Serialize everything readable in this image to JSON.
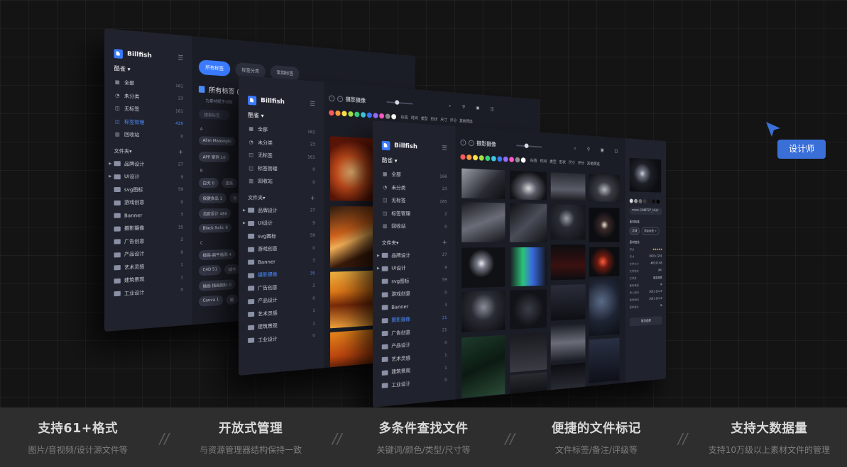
{
  "app": {
    "name": "Billfish",
    "library": "酷雀",
    "library_caret": "▾",
    "menu_icon": "☰",
    "nav": [
      {
        "label": "全部",
        "icon": "grid-icon",
        "glyph": "▦",
        "count": "161"
      },
      {
        "label": "未分类",
        "icon": "pie-icon",
        "glyph": "◔",
        "count": "23"
      },
      {
        "label": "无标签",
        "icon": "tag-icon",
        "glyph": "◫",
        "count": "161"
      },
      {
        "label": "标签管理",
        "icon": "tag-manage-icon",
        "glyph": "◫",
        "count": "429"
      },
      {
        "label": "回收站",
        "icon": "trash-icon",
        "glyph": "▥",
        "count": "0"
      }
    ],
    "folders_label": "文件夹",
    "folders_caret": "▾",
    "plus": "+",
    "folders": [
      {
        "label": "品牌设计",
        "count": "27",
        "expandable": true
      },
      {
        "label": "UI设计",
        "count": "9",
        "expandable": true
      },
      {
        "label": "svg图标",
        "count": "59",
        "expandable": false
      },
      {
        "label": "游戏创意",
        "count": "0",
        "expandable": false
      },
      {
        "label": "Banner",
        "count": "3",
        "expandable": false
      },
      {
        "label": "摄影摄像",
        "count": "35",
        "expandable": false
      },
      {
        "label": "广告创意",
        "count": "2",
        "expandable": false
      },
      {
        "label": "产品设计",
        "count": "0",
        "expandable": false
      },
      {
        "label": "艺术灵感",
        "count": "1",
        "expandable": false
      },
      {
        "label": "建筑景观",
        "count": "1",
        "expandable": false
      },
      {
        "label": "工业设计",
        "count": "0",
        "expandable": false
      }
    ]
  },
  "back_window": {
    "tabs": [
      "所有标签",
      "标签分类",
      "常用标签"
    ],
    "window_controls": "– □ ×",
    "title": "所有标签 (4",
    "subtitle": "为素材赋予对应",
    "search_placeholder": "搜索标签",
    "groups": [
      {
        "letter": "A",
        "rows": [
          [
            "Alim Maasoglu"
          ],
          [
            "APP 案例 10"
          ]
        ]
      },
      {
        "letter": "B",
        "rows": [
          [
            "白天 0",
            "皮肤"
          ],
          [
            "保健食品 1",
            "包"
          ],
          [
            "北欧设计 486"
          ],
          [
            "Black Italic 9"
          ]
        ]
      },
      {
        "letter": "C",
        "rows": [
          [
            "插画-扁平画图 4",
            "城市"
          ],
          [
            "C4D 51",
            "城市"
          ],
          [
            "插画-插画图标 0"
          ],
          [
            "Canva 1",
            "植"
          ]
        ]
      }
    ]
  },
  "mid_window": {
    "folder_counts": [
      "27",
      "9",
      "59",
      "0",
      "3",
      "35",
      "2",
      "0",
      "1",
      "1",
      "0"
    ],
    "nav_counts": [
      "161",
      "23",
      "161",
      "0",
      "0"
    ],
    "active_nav": 3,
    "active_folder": 5,
    "header_title": "摄影摄像",
    "filters": [
      "标签",
      "时间",
      "类型",
      "形状",
      "尺寸",
      "评分",
      "其他筛选"
    ]
  },
  "front_window": {
    "nav_counts": [
      "166",
      "23",
      "165",
      "2",
      "0"
    ],
    "folder_counts": [
      "27",
      "9",
      "59",
      "0",
      "3",
      "21",
      "21",
      "0",
      "1",
      "1",
      "0"
    ],
    "active_folder": 5,
    "header_title": "摄影摄像",
    "filters": [
      "标签",
      "时间",
      "类型",
      "形状",
      "尺寸",
      "评分",
      "其他筛选"
    ],
    "swatches": [
      "#ff5a5a",
      "#ff9a3c",
      "#ffe04a",
      "#a5e04a",
      "#36d17a",
      "#3ac7e0",
      "#3a7bff",
      "#9b6bff",
      "#ff5ac8",
      "#8d8d8d",
      "#ffffff"
    ],
    "detail": {
      "file_name": "moon-2048727_1920",
      "tags_label": "素材标签",
      "tag_chips": [
        "月球",
        "添加标签 +"
      ],
      "info_label": "素材信息",
      "rows": [
        {
          "k": "评分",
          "v": "★★★★★",
          "stars": true
        },
        {
          "k": "尺寸",
          "v": "1920×1281"
        },
        {
          "k": "文件大小",
          "v": "465.95 KB"
        },
        {
          "k": "文件格式",
          "v": "JPG"
        },
        {
          "k": "文件夹",
          "v": "摄影摄像"
        },
        {
          "k": "素材来源",
          "v": "⊞"
        },
        {
          "k": "导入时间",
          "v": "2021-10-29"
        },
        {
          "k": "修改时间",
          "v": "2021-10-29"
        },
        {
          "k": "素材备注",
          "v": "⊞"
        }
      ],
      "swatches": [
        "#d8d8d8",
        "#9a9a9a",
        "#6a6a6a",
        "#3a3a3a",
        "#1e1e1e",
        "#0c0c0c",
        "#000000"
      ],
      "action_button": "取消选择"
    }
  },
  "cursor_label": "设计师",
  "features": [
    {
      "title": "支持61+格式",
      "subtitle": "图片/音视频/设计源文件等"
    },
    {
      "title": "开放式管理",
      "subtitle": "与资源管理器结构保持一致"
    },
    {
      "title": "多条件查找文件",
      "subtitle": "关键词/颜色/类型/尺寸等"
    },
    {
      "title": "便捷的文件标记",
      "subtitle": "文件标签/备注/评级等"
    },
    {
      "title": "支持大数据量",
      "subtitle": "支持10万级以上素材文件的管理"
    }
  ],
  "separator": "//",
  "colors": {
    "accent": "#3a7bff",
    "tooltip": "#3a6fd8",
    "feature_bar": "#2e2e2e"
  }
}
